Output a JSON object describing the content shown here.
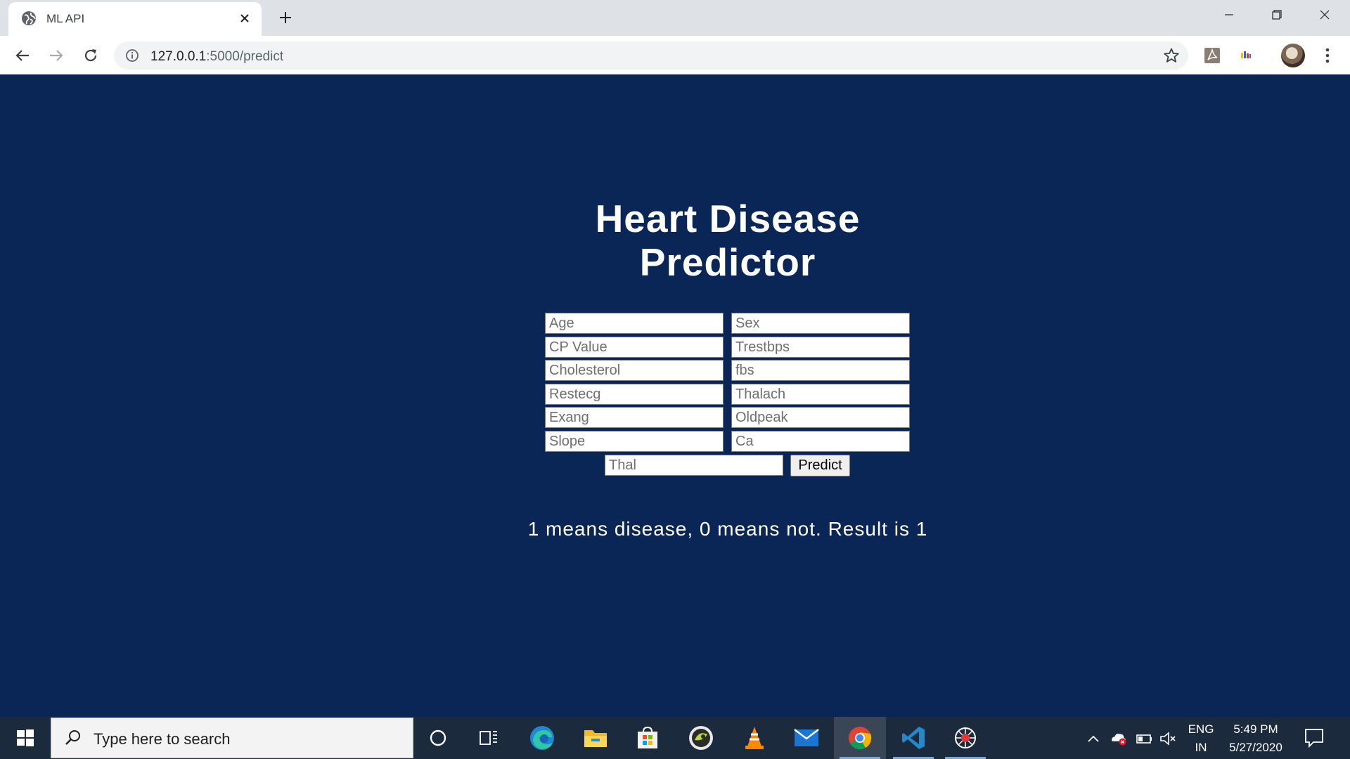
{
  "browser": {
    "tab_title": "ML API",
    "url_host": "127.0.0.1",
    "url_rest": ":5000/predict"
  },
  "page": {
    "title_line1": "Heart Disease",
    "title_line2": "Predictor",
    "fields": {
      "age": "Age",
      "sex": "Sex",
      "cp": "CP Value",
      "trestbps": "Trestbps",
      "chol": "Cholesterol",
      "fbs": "fbs",
      "restecg": "Restecg",
      "thalach": "Thalach",
      "exang": "Exang",
      "oldpeak": "Oldpeak",
      "slope": "Slope",
      "ca": "Ca",
      "thal": "Thal"
    },
    "predict_label": "Predict",
    "result_text": "1 means disease, 0 means not. Result is 1"
  },
  "taskbar": {
    "search_placeholder": "Type here to search",
    "language_top": "ENG",
    "language_bottom": "IN",
    "time": "5:49 PM",
    "date": "5/27/2020"
  },
  "colors": {
    "page_background": "#0a2657",
    "taskbar_background": "#1b2a3d"
  }
}
